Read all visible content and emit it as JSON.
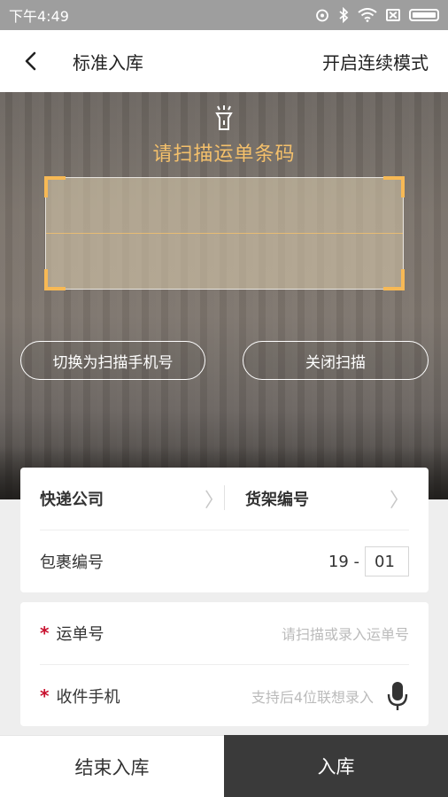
{
  "status_bar": {
    "time": "下午4:49",
    "icons": [
      "alarm-icon",
      "bluetooth-icon",
      "wifi-icon",
      "no-sim-icon",
      "battery-icon"
    ]
  },
  "header": {
    "title": "标准入库",
    "right_action": "开启连续模式",
    "back_icon": "chevron-left-icon"
  },
  "scanner": {
    "flash_icon": "flashlight-icon",
    "hint": "请扫描运单条码",
    "switch_button": "切换为扫描手机号",
    "close_button": "关闭扫描",
    "accent_color": "#f4c06b"
  },
  "form": {
    "courier_label": "快递公司",
    "shelf_label": "货架编号",
    "package_label": "包裹编号",
    "package_prefix": "19 -",
    "package_value": "01",
    "waybill_label": "运单号",
    "waybill_placeholder": "请扫描或录入运单号",
    "phone_label": "收件手机",
    "phone_placeholder": "支持后4位联想录入",
    "required_mark": "*",
    "mic_icon": "microphone-icon"
  },
  "bottom_bar": {
    "end_label": "结束入库",
    "submit_label": "入库",
    "submit_color": "#3a3a3a"
  }
}
